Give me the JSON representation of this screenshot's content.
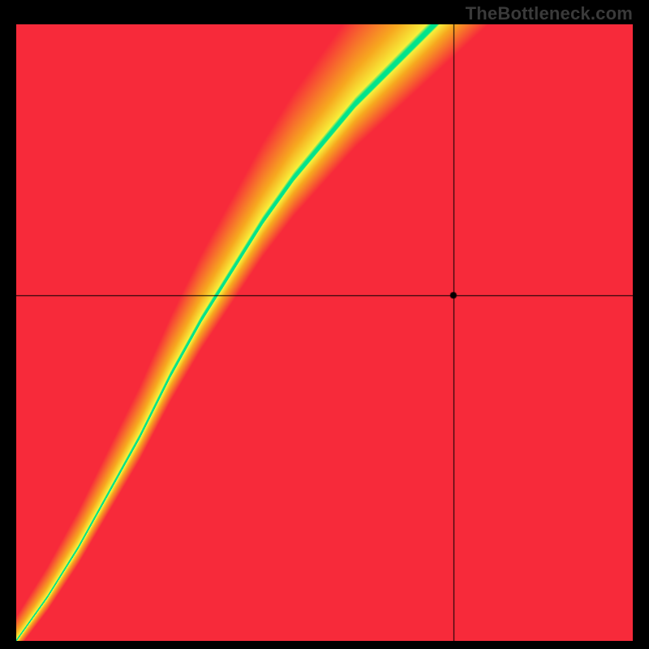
{
  "watermark": "TheBottleneck.com",
  "chart_data": {
    "type": "heatmap",
    "title": "",
    "xlabel": "",
    "ylabel": "",
    "x_range": [
      0,
      1
    ],
    "y_range": [
      0,
      1
    ],
    "crosshair": {
      "x": 0.71,
      "y": 0.56
    },
    "marker": {
      "x": 0.71,
      "y": 0.56,
      "radius": 4,
      "color": "#000000"
    },
    "description": "Bottleneck heatmap. Green ridge marks balanced pairs; yellow = mild mismatch; orange/red = strong bottleneck. Ridge runs roughly along y = 2x for x in [0,0.5] then y ≈ x + 0.5.",
    "optimal_curve_samples": [
      {
        "x": 0.0,
        "y": 0.0
      },
      {
        "x": 0.05,
        "y": 0.07
      },
      {
        "x": 0.1,
        "y": 0.15
      },
      {
        "x": 0.15,
        "y": 0.24
      },
      {
        "x": 0.2,
        "y": 0.33
      },
      {
        "x": 0.25,
        "y": 0.43
      },
      {
        "x": 0.3,
        "y": 0.52
      },
      {
        "x": 0.35,
        "y": 0.6
      },
      {
        "x": 0.4,
        "y": 0.68
      },
      {
        "x": 0.45,
        "y": 0.75
      },
      {
        "x": 0.5,
        "y": 0.81
      },
      {
        "x": 0.55,
        "y": 0.87
      },
      {
        "x": 0.6,
        "y": 0.92
      },
      {
        "x": 0.65,
        "y": 0.97
      },
      {
        "x": 0.68,
        "y": 1.0
      }
    ],
    "color_legend": {
      "ridge": "#00E38C",
      "near": "#F7EF3A",
      "mid": "#F7A81F",
      "far": "#F72A3A"
    }
  }
}
